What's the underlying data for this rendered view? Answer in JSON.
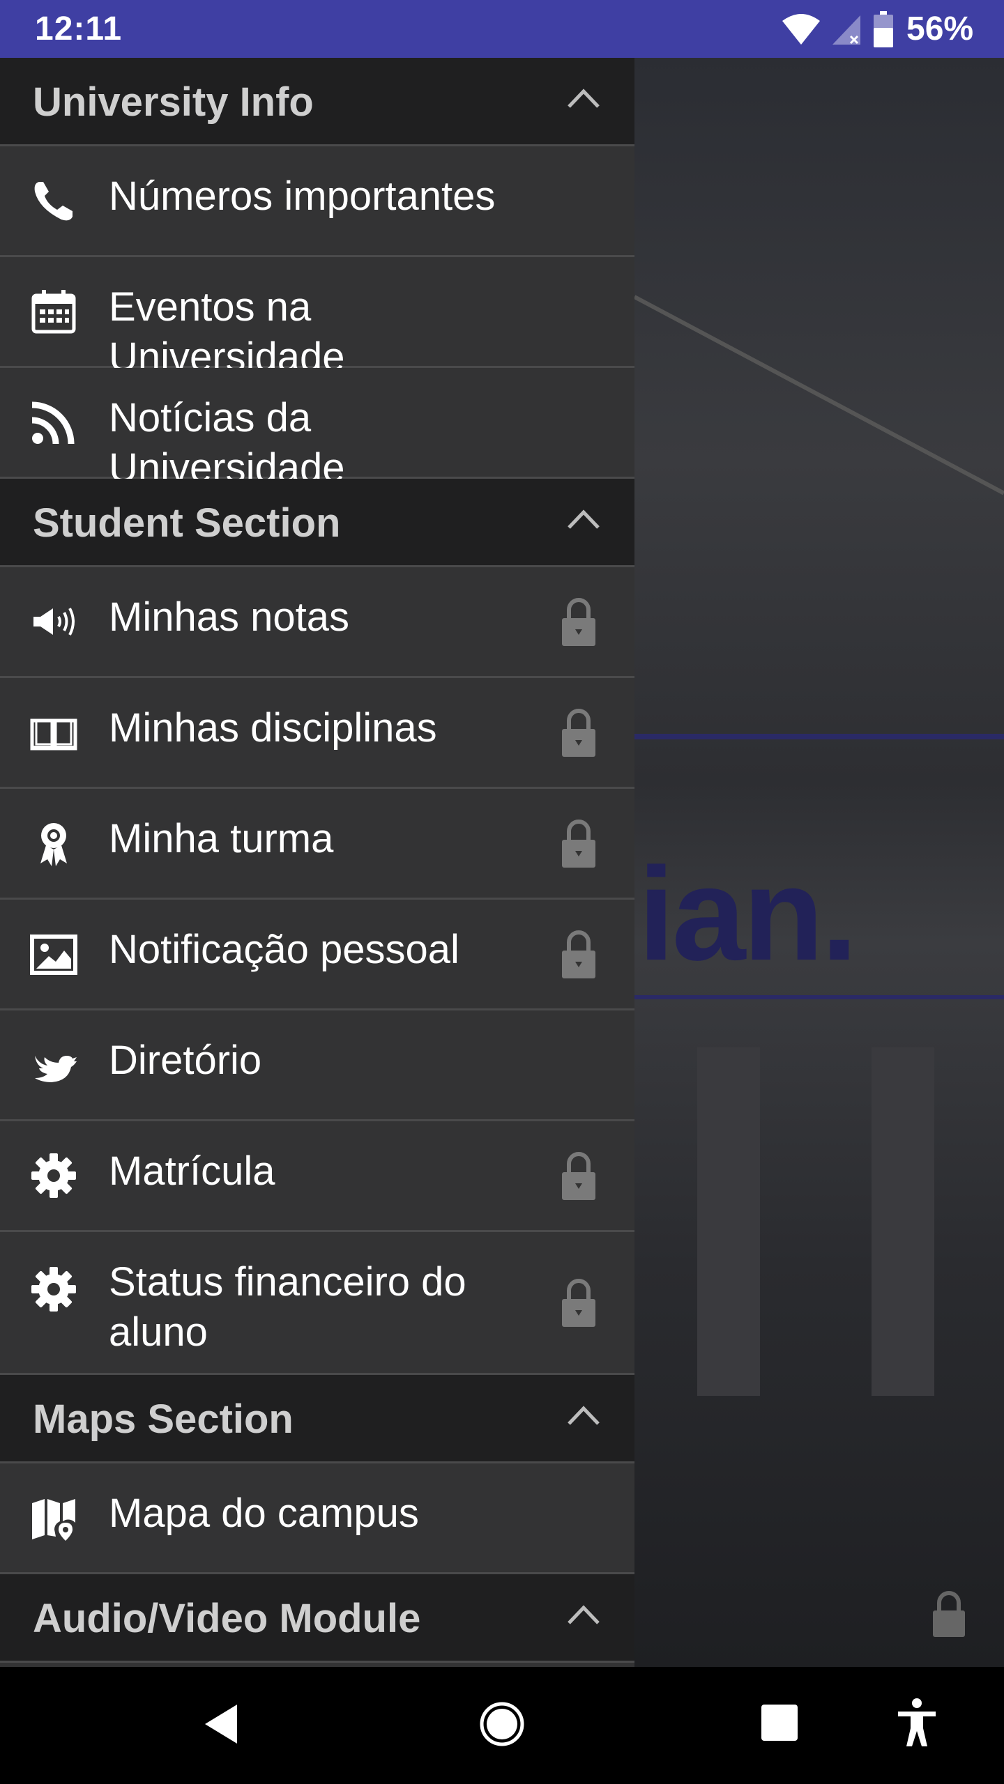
{
  "status_bar": {
    "time": "12:11",
    "battery_percent": "56%"
  },
  "background": {
    "logo_fragment": "ian."
  },
  "drawer": {
    "sections": [
      {
        "title": "University Info",
        "items": [
          {
            "label": "Números importantes",
            "icon": "phone-icon",
            "locked": false
          },
          {
            "label": "Eventos na Universidade",
            "icon": "calendar-icon",
            "locked": false
          },
          {
            "label": "Notícias da Universidade",
            "icon": "rss-icon",
            "locked": false
          }
        ]
      },
      {
        "title": "Student Section",
        "items": [
          {
            "label": "Minhas notas",
            "icon": "speaker-icon",
            "locked": true
          },
          {
            "label": "Minhas disciplinas",
            "icon": "book-icon",
            "locked": true
          },
          {
            "label": "Minha turma",
            "icon": "award-icon",
            "locked": true
          },
          {
            "label": "Notificação pessoal",
            "icon": "image-icon",
            "locked": true
          },
          {
            "label": "Diretório",
            "icon": "twitter-bird-icon",
            "locked": false
          },
          {
            "label": "Matrícula",
            "icon": "gear-icon",
            "locked": true
          },
          {
            "label": "Status financeiro do aluno",
            "icon": "gear-icon",
            "locked": true
          }
        ]
      },
      {
        "title": "Maps Section",
        "items": [
          {
            "label": "Mapa do campus",
            "icon": "map-icon",
            "locked": false
          }
        ]
      },
      {
        "title": "Audio/Video Module",
        "items": []
      }
    ]
  },
  "colors": {
    "status_bar": "#3f3fa3",
    "drawer_bg": "#333334",
    "header_bg": "#1f1f20",
    "text": "#ffffff",
    "header_text": "#cfcfcf"
  }
}
